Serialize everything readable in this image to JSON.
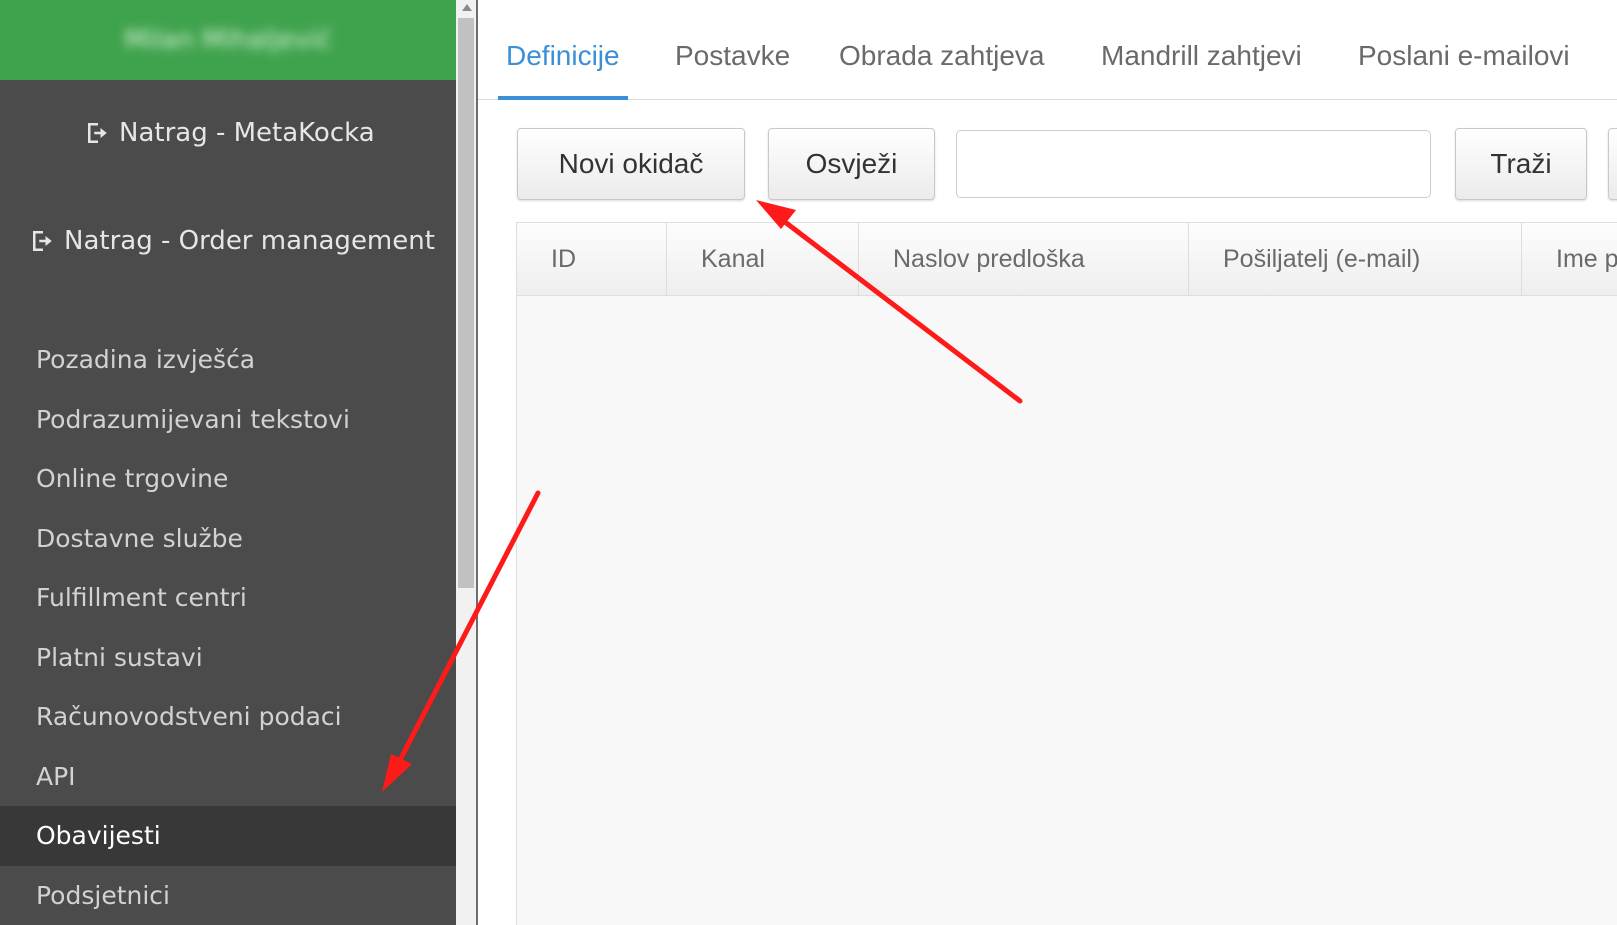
{
  "sidebar": {
    "user_name": "Milan Mihaljević",
    "back_links": [
      {
        "label": "Natrag - MetaKocka",
        "icon": "sign-out-icon"
      },
      {
        "label": "Natrag - Order management",
        "icon": "sign-out-icon"
      }
    ],
    "items": [
      {
        "label": "Pozadina izvješća"
      },
      {
        "label": "Podrazumijevani tekstovi"
      },
      {
        "label": "Online trgovine"
      },
      {
        "label": "Dostavne službe"
      },
      {
        "label": "Fulfillment centri"
      },
      {
        "label": "Platni sustavi"
      },
      {
        "label": "Računovodstveni podaci"
      },
      {
        "label": "API"
      },
      {
        "label": "Obavijesti",
        "active": true
      },
      {
        "label": "Podsjetnici"
      }
    ]
  },
  "tabs": [
    {
      "label": "Definicije",
      "active": true
    },
    {
      "label": "Postavke"
    },
    {
      "label": "Obrada zahtjeva"
    },
    {
      "label": "Mandrill zahtjevi"
    },
    {
      "label": "Poslani e-mailovi"
    }
  ],
  "toolbar": {
    "new_trigger_label": "Novi okidač",
    "refresh_label": "Osvježi",
    "search_value": "",
    "search_button_label": "Traži"
  },
  "grid": {
    "columns": [
      "ID",
      "Kanal",
      "Naslov predloška",
      "Pošiljatelj (e-mail)",
      "Ime p"
    ]
  },
  "colors": {
    "header_green": "#3fa34d",
    "sidebar_bg": "#4b4b4b",
    "accent_blue": "#3a8fd6",
    "annotation_red": "#ff1a1a"
  }
}
